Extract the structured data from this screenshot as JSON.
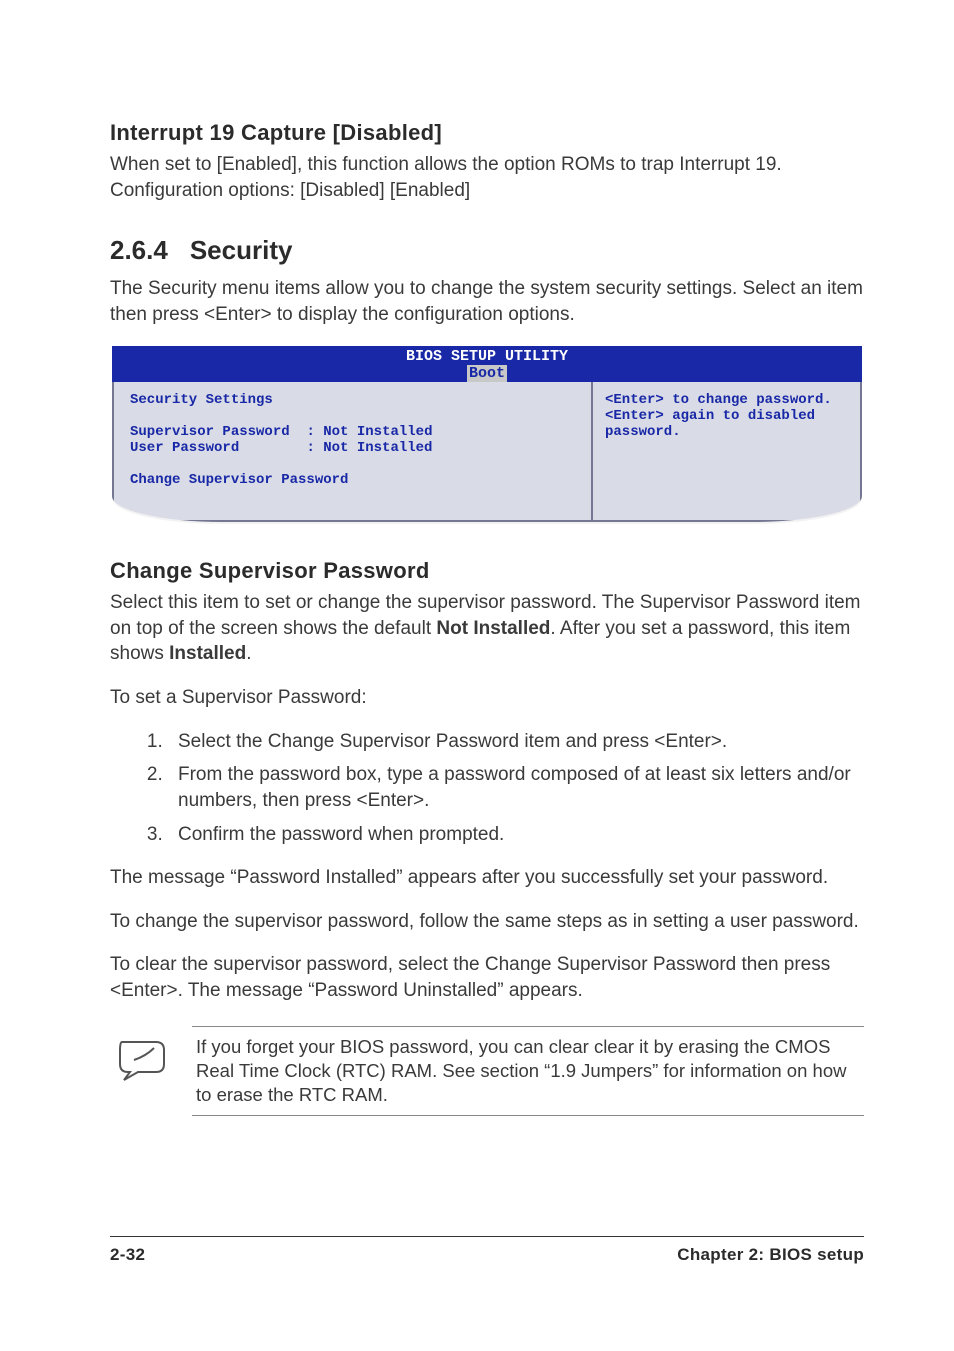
{
  "section1": {
    "heading": "Interrupt 19 Capture [Disabled]",
    "body": "When set to [Enabled], this function allows the option ROMs to trap Interrupt 19. Configuration options: [Disabled] [Enabled]"
  },
  "section2": {
    "num": "2.6.4",
    "title": "Security",
    "intro": "The Security menu items allow you to change the system security settings. Select an item then press <Enter> to display the configuration options."
  },
  "bios": {
    "header_line1": "BIOS SETUP UTILITY",
    "header_tab": "Boot",
    "left_title": "Security Settings",
    "row1_label": "Supervisor Password",
    "row1_value": ": Not Installed",
    "row2_label": "User Password",
    "row2_value": ": Not Installed",
    "selectable": "Change Supervisor Password",
    "help1": "<Enter> to change password.",
    "help2": "<Enter> again to disabled password."
  },
  "section3": {
    "heading": "Change Supervisor Password",
    "p1a": "Select this item to set or change the supervisor password. The Supervisor Password item on top of the screen shows the default ",
    "p1b": "Not Installed",
    "p1c": ". After you set a password, this item shows ",
    "p1d": "Installed",
    "p1e": ".",
    "p2": "To set a Supervisor Password:",
    "steps": [
      "Select the Change Supervisor Password item and press <Enter>.",
      "From the password box, type a password composed of at least six letters and/or numbers, then press <Enter>.",
      "Confirm the password when prompted."
    ],
    "p3": "The message “Password Installed” appears after you successfully set your password.",
    "p4": "To change the supervisor password, follow the same steps as in setting a user password.",
    "p5": "To clear the supervisor password, select the Change Supervisor Password then press <Enter>. The message “Password Uninstalled” appears."
  },
  "note": {
    "text": "If you forget your BIOS password, you can clear clear it by erasing the CMOS Real Time Clock (RTC) RAM. See section “1.9  Jumpers” for information on how to erase the RTC RAM."
  },
  "footer": {
    "left": "2-32",
    "right": "Chapter 2: BIOS setup"
  }
}
